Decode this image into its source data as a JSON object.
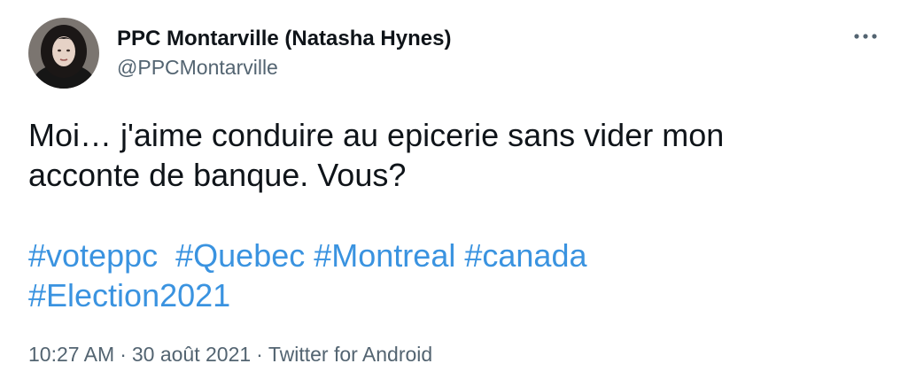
{
  "author": {
    "display_name": "PPC Montarville (Natasha Hynes)",
    "handle": "@PPCMontarville",
    "avatar_icon": "profile-photo"
  },
  "more_icon": "more-horizontal-icon",
  "tweet": {
    "line1": "Moi… j'aime conduire au epicerie sans vider mon",
    "line2": "acconte de banque. Vous?",
    "hashtags": [
      "#voteppc",
      "#Quebec",
      "#Montreal",
      "#canada",
      "#Election2021"
    ]
  },
  "meta": {
    "time": "10:27 AM",
    "separator": "·",
    "date": "30 août 2021",
    "source": "Twitter for Android"
  },
  "colors": {
    "hashtag": "#3a93e0",
    "secondary_text": "#536471",
    "primary_text": "#0f1419"
  }
}
